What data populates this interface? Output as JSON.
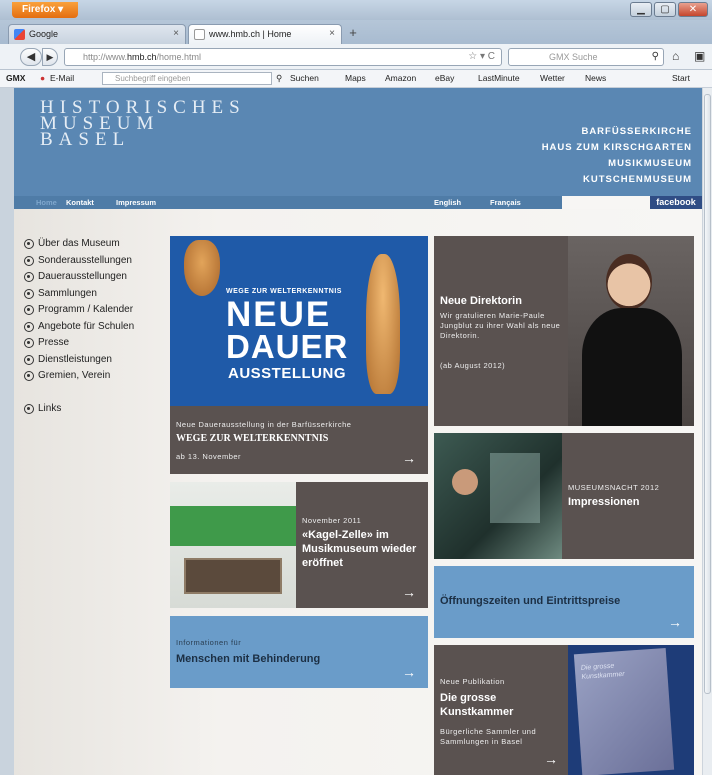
{
  "browser": {
    "app_button": "Firefox",
    "tabs": [
      {
        "label": "Google"
      },
      {
        "label": "www.hmb.ch | Home"
      }
    ],
    "new_tab": "+",
    "url_prefix": "http://www.",
    "url_domain": "hmb.ch",
    "url_path": "/home.html",
    "search_placeholder": "GMX Suche",
    "bookmarks": {
      "gmx": "GMX",
      "email": "E-Mail",
      "search_placeholder": "Suchbegriff eingeben",
      "suchen": "Suchen",
      "maps": "Maps",
      "amazon": "Amazon",
      "ebay": "eBay",
      "lastminute": "LastMinute",
      "wetter": "Wetter",
      "news": "News",
      "start": "Start"
    }
  },
  "site": {
    "logo": [
      "HISTORISCHES",
      "MUSEUM",
      "BASEL"
    ],
    "museums": [
      "BARFÜSSERKIRCHE",
      "HAUS ZUM KIRSCHGARTEN",
      "MUSIKMUSEUM",
      "KUTSCHENMUSEUM"
    ],
    "menu": {
      "home": "Home",
      "kontakt": "Kontakt",
      "impressum": "Impressum",
      "english": "English",
      "francais": "Français",
      "facebook": "facebook"
    },
    "sidebar": [
      "Über das Museum",
      "Sonderausstellungen",
      "Dauerausstellungen",
      "Sammlungen",
      "Programm / Kalender",
      "Angebote für Schulen",
      "Presse",
      "Dienstleistungen",
      "Gremien, Verein"
    ],
    "sidebar_links": "Links",
    "tiles": {
      "dauer": {
        "kicker": "WEGE ZUR WELTERKENNTNIS",
        "big1": "NEUE",
        "big2": "DAUER",
        "big3": "AUSSTELLUNG",
        "sub": "Neue Dauerausstellung in der Barfüsserkirche",
        "title": "WEGE ZUR WELTERKENNTNIS",
        "date": "ab 13. November"
      },
      "direktorin": {
        "title": "Neue Direktorin",
        "text": "Wir gratulieren Marie-Paule Jungblut zu ihrer Wahl als neue Direktorin.",
        "date": "(ab August 2012)"
      },
      "museumsnacht": {
        "sub": "MUSEUMSNACHT 2012",
        "title": "Impressionen"
      },
      "kagel": {
        "sub": "November 2011",
        "title": "«Kagel-Zelle» im Musikmuseum wieder eröffnet"
      },
      "oeffnung": {
        "title": "Öffnungszeiten und Eintrittspreise"
      },
      "behinderung": {
        "sub": "Informationen für",
        "title": "Menschen mit Behinderung"
      },
      "publikation": {
        "sub": "Neue Publikation",
        "title": "Die grosse Kunstkammer",
        "text": "Bürgerliche Sammler und Sammlungen in Basel",
        "book_title": "Die grosse Kunstkammer"
      }
    },
    "arrow": "→"
  },
  "colors": {
    "header_blue": "#5a87b3",
    "tile_dark": "#5a5250",
    "tile_blue": "#6a9cc9",
    "poster_blue": "#1f5aa8"
  }
}
